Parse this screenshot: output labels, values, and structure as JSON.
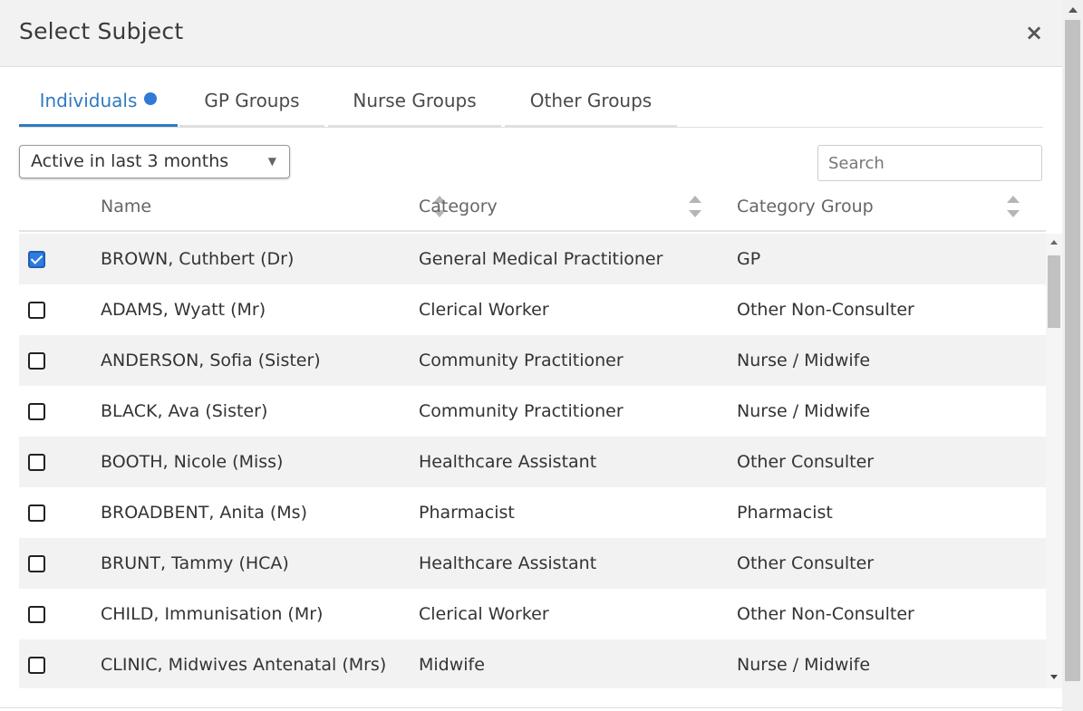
{
  "dialog": {
    "title": "Select Subject",
    "close_label": "×"
  },
  "tabs": [
    {
      "label": "Individuals",
      "active": true,
      "has_indicator": true
    },
    {
      "label": "GP Groups",
      "active": false
    },
    {
      "label": "Nurse Groups",
      "active": false
    },
    {
      "label": "Other Groups",
      "active": false
    }
  ],
  "filter": {
    "selected": "Active in last 3 months",
    "caret": "▼"
  },
  "search": {
    "placeholder": "Search",
    "value": ""
  },
  "table": {
    "columns": [
      {
        "label": "Name",
        "sortable": true
      },
      {
        "label": "Category",
        "sortable": true
      },
      {
        "label": "Category Group",
        "sortable": true
      }
    ],
    "rows": [
      {
        "checked": true,
        "name": "BROWN, Cuthbert (Dr)",
        "category": "General Medical Practitioner",
        "group": "GP"
      },
      {
        "checked": false,
        "name": "ADAMS, Wyatt (Mr)",
        "category": "Clerical Worker",
        "group": "Other Non-Consulter"
      },
      {
        "checked": false,
        "name": "ANDERSON, Sofia (Sister)",
        "category": "Community Practitioner",
        "group": "Nurse / Midwife"
      },
      {
        "checked": false,
        "name": "BLACK, Ava (Sister)",
        "category": "Community Practitioner",
        "group": "Nurse / Midwife"
      },
      {
        "checked": false,
        "name": "BOOTH, Nicole (Miss)",
        "category": "Healthcare Assistant",
        "group": "Other Consulter"
      },
      {
        "checked": false,
        "name": "BROADBENT, Anita (Ms)",
        "category": "Pharmacist",
        "group": "Pharmacist"
      },
      {
        "checked": false,
        "name": "BRUNT, Tammy (HCA)",
        "category": "Healthcare Assistant",
        "group": "Other Consulter"
      },
      {
        "checked": false,
        "name": "CHILD, Immunisation (Mr)",
        "category": "Clerical Worker",
        "group": "Other Non-Consulter"
      },
      {
        "checked": false,
        "name": "CLINIC, Midwives Antenatal (Mrs)",
        "category": "Midwife",
        "group": "Nurse / Midwife"
      }
    ]
  },
  "colors": {
    "accent": "#2f7bbf",
    "checkbox_checked": "#2d7ce0",
    "header_bg": "#f2f2f2",
    "row_alt_bg": "#f2f2f2"
  }
}
